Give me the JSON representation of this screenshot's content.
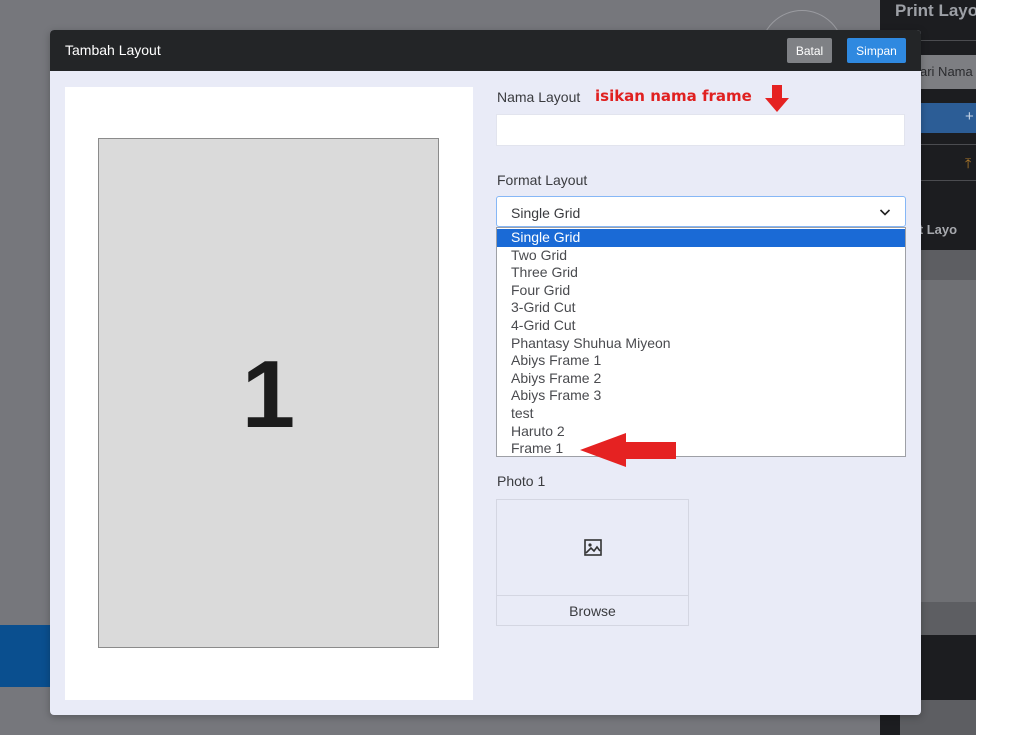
{
  "background": {
    "panel_title": "Print Layo",
    "search_placeholder": "ari Nama",
    "add_glyph": "+",
    "upload_glyph": "⤒",
    "default_label": "ault Layo"
  },
  "modal": {
    "title": "Tambah Layout",
    "cancel_label": "Batal",
    "save_label": "Simpan"
  },
  "preview": {
    "cell_number": "1"
  },
  "form": {
    "name_label": "Nama Layout",
    "name_annotation": "isikan nama frame",
    "name_value": "",
    "format_label": "Format Layout",
    "format_selected": "Single Grid",
    "format_options": [
      "Single Grid",
      "Two Grid",
      "Three Grid",
      "Four Grid",
      "3-Grid Cut",
      "4-Grid Cut",
      "Phantasy Shuhua Miyeon",
      "Abiys Frame 1",
      "Abiys Frame 2",
      "Abiys Frame 3",
      "test",
      "Haruto 2",
      "Frame 1"
    ],
    "photo_label": "Photo 1",
    "browse_label": "Browse"
  },
  "colors": {
    "header_bg": "#232527",
    "save_button": "#2f89e0",
    "cancel_button": "#7f8185",
    "selected_option": "#1a6ad6",
    "annotation_red": "#e02020"
  },
  "icons": {
    "photo": "image-icon",
    "dropdown": "chevron-down-icon",
    "annotation_down": "red-arrow-down-icon",
    "annotation_left": "red-arrow-left-icon"
  }
}
